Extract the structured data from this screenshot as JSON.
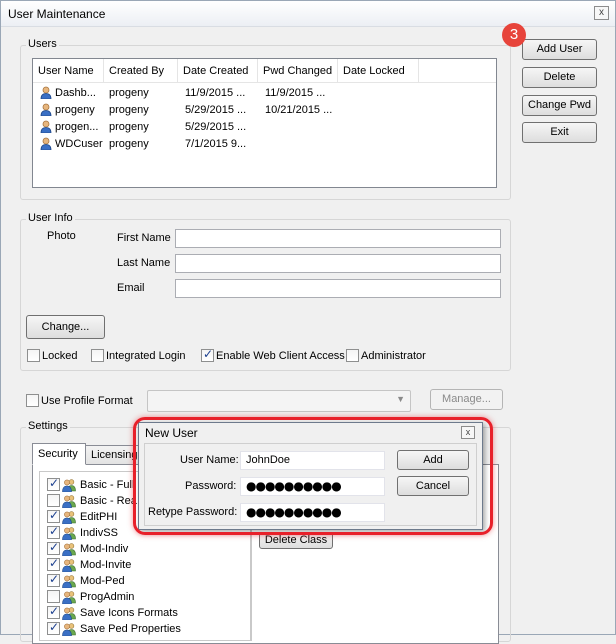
{
  "window": {
    "title": "User Maintenance",
    "close_glyph": "x"
  },
  "step_badge": "3",
  "buttons": {
    "add_user": "Add User",
    "delete": "Delete",
    "change_pwd": "Change Pwd",
    "exit": "Exit"
  },
  "users": {
    "legend": "Users",
    "columns": [
      "User Name",
      "Created By",
      "Date Created",
      "Pwd Changed",
      "Date Locked"
    ],
    "rows": [
      {
        "user_name": "Dashb...",
        "created_by": "progeny",
        "date_created": "11/9/2015 ...",
        "pwd_changed": "11/9/2015 ...",
        "date_locked": ""
      },
      {
        "user_name": "progeny",
        "created_by": "progeny",
        "date_created": "5/29/2015 ...",
        "pwd_changed": "10/21/2015 ...",
        "date_locked": ""
      },
      {
        "user_name": "progen...",
        "created_by": "progeny",
        "date_created": "5/29/2015 ...",
        "pwd_changed": "",
        "date_locked": ""
      },
      {
        "user_name": "WDCuser",
        "created_by": "progeny",
        "date_created": "7/1/2015 9...",
        "pwd_changed": "",
        "date_locked": ""
      }
    ]
  },
  "user_info": {
    "legend": "User Info",
    "photo_label": "Photo",
    "first_name_label": "First Name",
    "last_name_label": "Last Name",
    "email_label": "Email",
    "first_name": "",
    "last_name": "",
    "email": "",
    "change_button": "Change...",
    "checks": {
      "locked": {
        "label": "Locked",
        "checked": false
      },
      "integrated_login": {
        "label": "Integrated Login",
        "checked": false
      },
      "web_client": {
        "label": "Enable Web Client Access",
        "checked": true
      },
      "administrator": {
        "label": "Administrator",
        "checked": false
      }
    }
  },
  "profile": {
    "label": "Use Profile Format",
    "checked": false,
    "combo_value": "",
    "manage_button": "Manage..."
  },
  "settings": {
    "legend": "Settings",
    "tabs": [
      "Security",
      "Licensing"
    ],
    "active_tab": "Security",
    "permissions": [
      {
        "label": "Basic - Full",
        "checked": true
      },
      {
        "label": "Basic - Rea",
        "checked": false
      },
      {
        "label": "EditPHI",
        "checked": true
      },
      {
        "label": "IndivSS",
        "checked": true
      },
      {
        "label": "Mod-Indiv",
        "checked": true
      },
      {
        "label": "Mod-Invite",
        "checked": true
      },
      {
        "label": "Mod-Ped",
        "checked": true
      },
      {
        "label": "ProgAdmin",
        "checked": false
      },
      {
        "label": "Save Icons Formats",
        "checked": true
      },
      {
        "label": "Save Ped Properties",
        "checked": true
      }
    ],
    "delete_class_button": "Delete Class"
  },
  "new_user_dialog": {
    "title": "New User",
    "close_glyph": "x",
    "user_name_label": "User Name:",
    "password_label": "Password:",
    "retype_label": "Retype Password:",
    "user_name": "JohnDoe",
    "password": "●●●●●●●●●●",
    "retype": "●●●●●●●●●●",
    "add_button": "Add",
    "cancel_button": "Cancel"
  },
  "colors": {
    "highlight": "#e8202a",
    "badge": "#e7443b",
    "accent_check": "#1b3f8f"
  }
}
